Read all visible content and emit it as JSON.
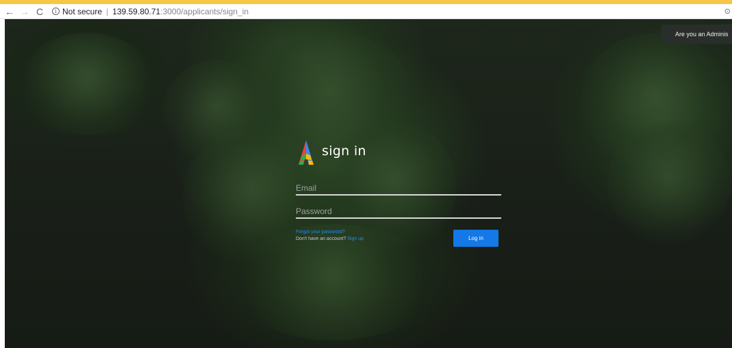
{
  "browser": {
    "back_glyph": "←",
    "forward_glyph": "→",
    "reload_glyph": "C",
    "info_glyph": "i",
    "security_text": "Not secure",
    "separator": "|",
    "url_host": "139.59.80.71",
    "url_rest": ":3000/applicants/sign_in",
    "menu_glyph": "⊙"
  },
  "header": {
    "admin_button_label": "Are you an Adminis"
  },
  "signin": {
    "title": "sign in",
    "email_placeholder": "Email",
    "password_placeholder": "Password",
    "forgot_password": "Forgot your password?",
    "no_account_text": "Don't have an account?",
    "sign_up": "Sign up",
    "login_button": "Log in"
  },
  "colors": {
    "accent_bar": "#f6c744",
    "primary_button": "#1478e6",
    "link": "#1a8cff"
  },
  "icons": [
    "back-arrow-icon",
    "forward-arrow-icon",
    "reload-icon",
    "info-icon",
    "logo-icon"
  ]
}
